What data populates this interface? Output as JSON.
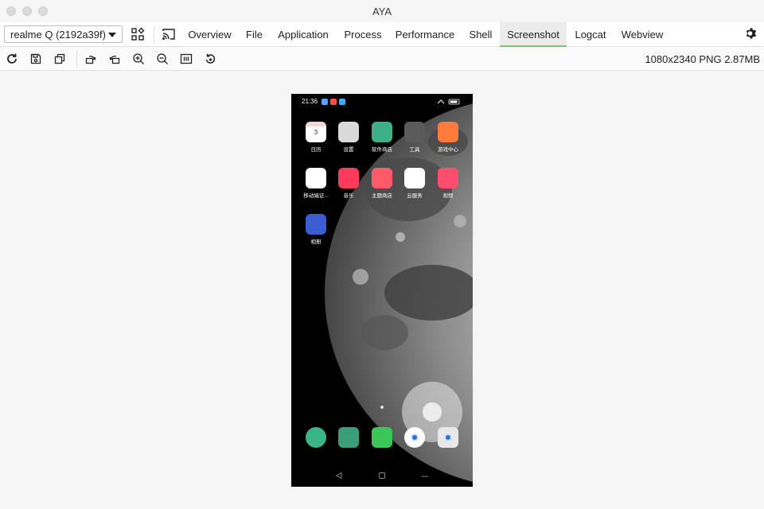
{
  "window": {
    "title": "AYA"
  },
  "nav": {
    "device": "realme Q (2192a39f)",
    "tabs": [
      "Overview",
      "File",
      "Application",
      "Process",
      "Performance",
      "Shell",
      "Screenshot",
      "Logcat",
      "Webview"
    ],
    "active_tab": "Screenshot"
  },
  "toolbar": {
    "tools": [
      "refresh-icon",
      "save-icon",
      "copy-icon",
      "rotate-left-icon",
      "rotate-right-icon",
      "zoom-in-icon",
      "zoom-out-icon",
      "fit-icon",
      "reset-icon"
    ],
    "image_info": "1080x2340 PNG 2.87MB"
  },
  "phone": {
    "status_time": "21:36",
    "apps": [
      {
        "label": "日历",
        "icon": "calendar-icon",
        "color": "#ffffff",
        "badge": "3"
      },
      {
        "label": "设置",
        "icon": "settings-icon",
        "color": "#d9d9d9"
      },
      {
        "label": "软件商店",
        "icon": "store-icon",
        "color": "#3fae8a"
      },
      {
        "label": "工具",
        "icon": "tools-folder-icon",
        "color": "#5a5a5a"
      },
      {
        "label": "游戏中心",
        "icon": "game-center-icon",
        "color": "#ff7a3d"
      },
      {
        "label": "移动端证...",
        "icon": "mobile-cert-icon",
        "color": "#ffffff"
      },
      {
        "label": "音乐",
        "icon": "music-icon",
        "color": "#ff3b5c"
      },
      {
        "label": "主题商店",
        "icon": "theme-store-icon",
        "color": "#ff5a6a"
      },
      {
        "label": "云服务",
        "icon": "cloud-service-icon",
        "color": "#ffffff"
      },
      {
        "label": "视频",
        "icon": "video-icon",
        "color": "#ff4d6d"
      },
      {
        "label": "相册",
        "icon": "album-icon",
        "color": "#3b5bd1"
      }
    ],
    "dock": [
      {
        "icon": "phone-icon",
        "color": "#3ab58a"
      },
      {
        "icon": "messages-icon",
        "color": "#3a9e7a"
      },
      {
        "icon": "wechat-icon",
        "color": "#3cc65a"
      },
      {
        "icon": "browser-icon",
        "color": "#ffffff"
      },
      {
        "icon": "camera-icon",
        "color": "#e8e8e8"
      }
    ]
  }
}
